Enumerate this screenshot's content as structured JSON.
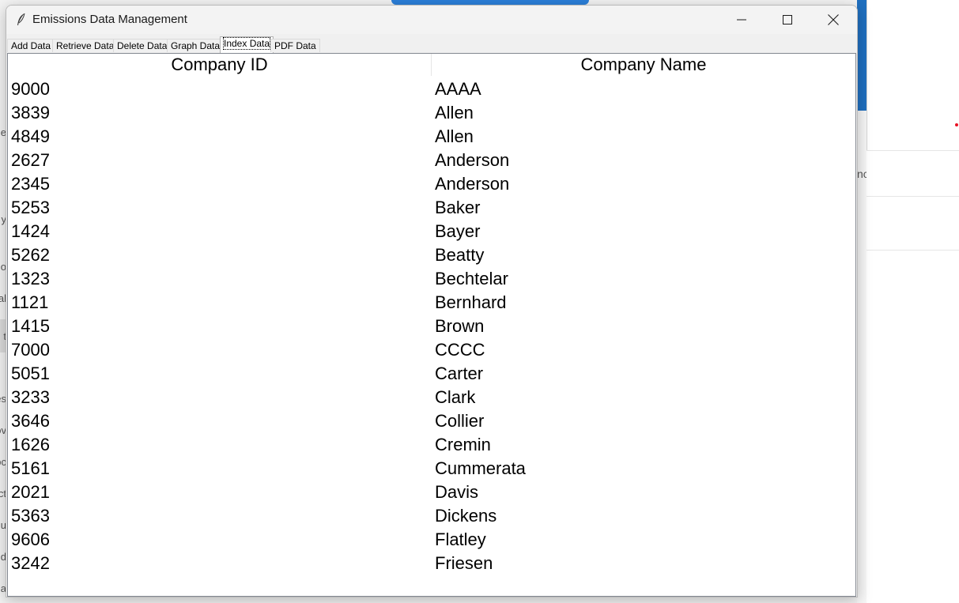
{
  "window": {
    "title": "Emissions Data Management",
    "icon": "feather-icon"
  },
  "tabs": [
    {
      "label": "Add Data",
      "active": false
    },
    {
      "label": "Retrieve Data",
      "active": false
    },
    {
      "label": "Delete Data",
      "active": false
    },
    {
      "label": "Graph Data",
      "active": false
    },
    {
      "label": "Index Data",
      "active": true
    },
    {
      "label": "PDF Data",
      "active": false
    }
  ],
  "table": {
    "columns": [
      "Company ID",
      "Company Name"
    ],
    "rows": [
      {
        "id": "9000",
        "name": "AAAA"
      },
      {
        "id": "3839",
        "name": "Allen"
      },
      {
        "id": "4849",
        "name": "Allen"
      },
      {
        "id": "2627",
        "name": "Anderson"
      },
      {
        "id": "2345",
        "name": "Anderson"
      },
      {
        "id": "5253",
        "name": "Baker"
      },
      {
        "id": "1424",
        "name": "Bayer"
      },
      {
        "id": "5262",
        "name": "Beatty"
      },
      {
        "id": "1323",
        "name": "Bechtelar"
      },
      {
        "id": "1121",
        "name": "Bernhard"
      },
      {
        "id": "1415",
        "name": "Brown"
      },
      {
        "id": "7000",
        "name": "CCCC"
      },
      {
        "id": "5051",
        "name": "Carter"
      },
      {
        "id": "3233",
        "name": "Clark"
      },
      {
        "id": "3646",
        "name": "Collier"
      },
      {
        "id": "1626",
        "name": "Cremin"
      },
      {
        "id": "5161",
        "name": "Cummerata"
      },
      {
        "id": "2021",
        "name": "Davis"
      },
      {
        "id": "5363",
        "name": "Dickens"
      },
      {
        "id": "9606",
        "name": "Flatley"
      },
      {
        "id": "3242",
        "name": "Friesen"
      }
    ]
  },
  "background": {
    "left_fragments": [
      "e",
      "y",
      "o",
      "al",
      "t",
      "es",
      "ov",
      "oc",
      "ct",
      "u",
      "d",
      "a"
    ],
    "right_fragment": "nc"
  },
  "colors": {
    "accent_blue": "#1f6fbf",
    "close_red": "#e81123"
  }
}
